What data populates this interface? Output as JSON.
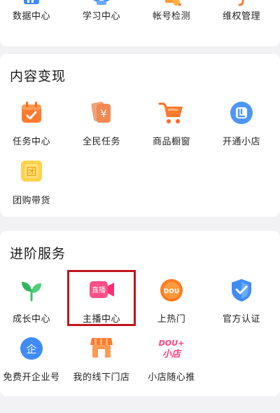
{
  "top_row": {
    "items": [
      {
        "label": "数据中心",
        "icon": "chart-icon"
      },
      {
        "label": "学习中心",
        "icon": "cap-icon"
      },
      {
        "label": "帐号检测",
        "icon": "check-icon"
      },
      {
        "label": "维权管理",
        "icon": "hook-icon"
      }
    ]
  },
  "content_section": {
    "title": "内容变现",
    "items": [
      {
        "label": "任务中心",
        "icon": "calendar-icon"
      },
      {
        "label": "全民任务",
        "icon": "yen-icon"
      },
      {
        "label": "商品橱窗",
        "icon": "cart-icon"
      },
      {
        "label": "开通小店",
        "icon": "shop-icon"
      },
      {
        "label": "团购带货",
        "icon": "group-buy-icon"
      }
    ]
  },
  "advanced_section": {
    "title": "进阶服务",
    "items": [
      {
        "label": "成长中心",
        "icon": "sprout-icon"
      },
      {
        "label": "主播中心",
        "icon": "live-camera-icon",
        "icon_text": "直播"
      },
      {
        "label": "上热门",
        "icon": "dou-icon",
        "icon_text": "DOU"
      },
      {
        "label": "官方认证",
        "icon": "shield-check-icon"
      },
      {
        "label": "免费开企业号",
        "icon": "enterprise-icon",
        "icon_text": "企"
      },
      {
        "label": "我的线下门店",
        "icon": "storefront-icon"
      },
      {
        "label": "小店随心推",
        "icon": "dou-plus-icon",
        "icon_text_line1": "DOU+",
        "icon_text_line2": "小店"
      }
    ]
  },
  "colors": {
    "accent_red": "#c0161e",
    "orange": "#ff7a2e",
    "blue": "#3f8cf5",
    "green": "#3fbf6a",
    "pink": "#ff4f86"
  }
}
